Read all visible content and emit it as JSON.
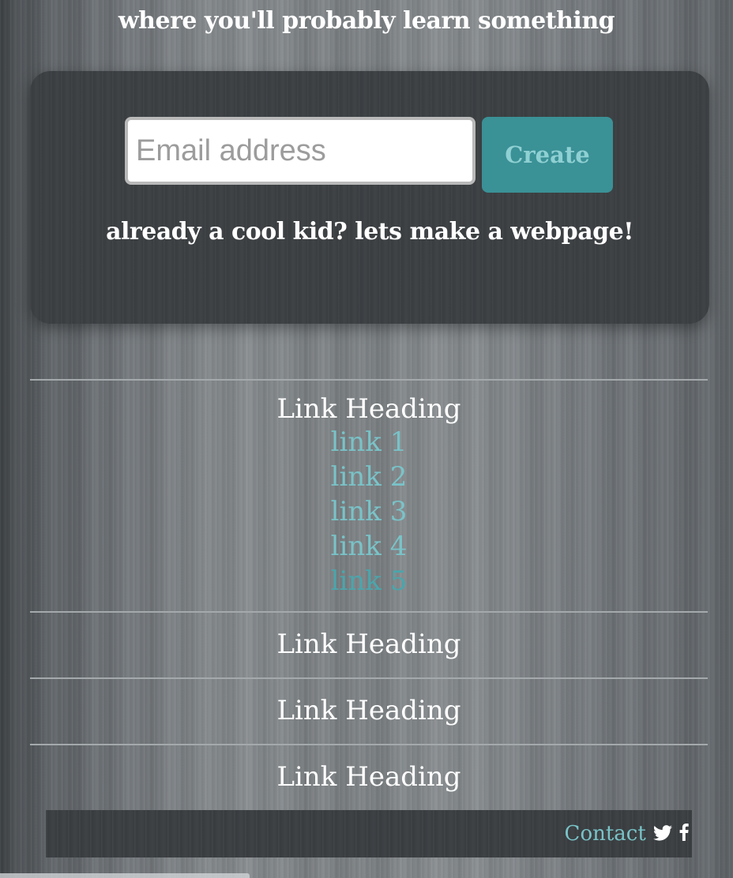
{
  "hero": {
    "tagline": "where you'll probably learn something"
  },
  "signup": {
    "email_placeholder": "Email address",
    "create_label": "Create",
    "login_prompt": "already a cool kid? lets make a webpage!"
  },
  "link_sections": [
    {
      "heading": "Link Heading",
      "links": [
        "link 1",
        "link 2",
        "link 3",
        "link 4",
        "link 5"
      ]
    },
    {
      "heading": "Link Heading"
    },
    {
      "heading": "Link Heading"
    },
    {
      "heading": "Link Heading"
    }
  ],
  "footer": {
    "contact_label": "Contact",
    "icons": [
      "twitter-icon",
      "facebook-icon"
    ]
  },
  "colors": {
    "accent": "#3a9196",
    "link": "#79c3c8",
    "active_link": "#4aa6ac",
    "panel": "#3c4043"
  }
}
